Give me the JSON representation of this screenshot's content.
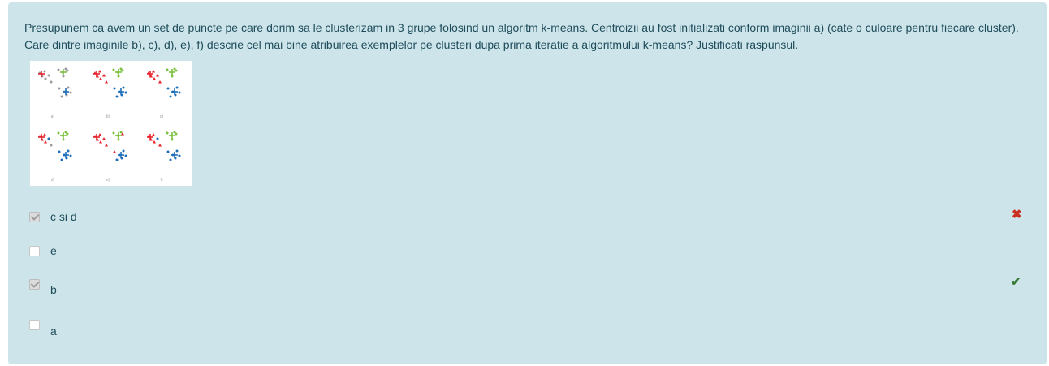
{
  "question": {
    "text": "Presupunem ca avem un set de puncte pe care dorim sa le clusterizam in 3 grupe folosind un algoritm k-means. Centroizii au fost initializati conform imaginii a) (cate o culoare pentru fiecare cluster). Care dintre imaginile b), c), d), e), f) descrie cel mai bine atribuirea exemplelor pe clusteri dupa prima iteratie a algoritmului k-means? Justificati raspunsul."
  },
  "figure": {
    "panel_labels": [
      "a)",
      "b)",
      "c)",
      "d)",
      "e)",
      "f)"
    ],
    "colors": {
      "red": "#e8202a",
      "green": "#7cc142",
      "blue": "#1f6fb8",
      "gray": "#9a9a9a"
    }
  },
  "options": [
    {
      "label": "c si d",
      "checked": true,
      "feedback": "incorrect",
      "feedback_icon": "cross-icon"
    },
    {
      "label": "e",
      "checked": false
    },
    {
      "label": "b",
      "checked": true,
      "feedback": "correct",
      "feedback_icon": "check-icon"
    },
    {
      "label": "a",
      "checked": false
    }
  ],
  "feedback_glyphs": {
    "incorrect": "✖",
    "correct": "✔"
  }
}
